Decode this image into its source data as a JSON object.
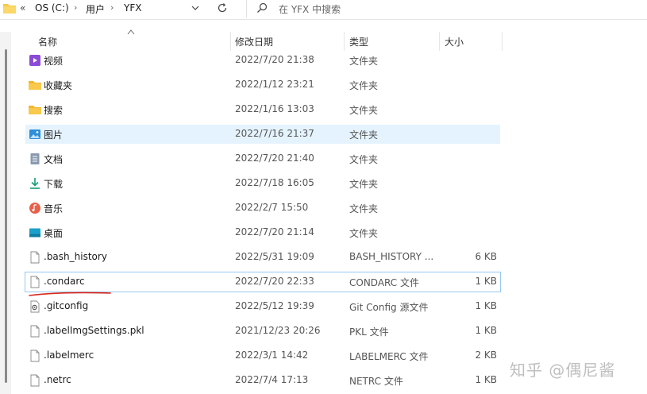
{
  "address_bar": {
    "breadcrumbs": [
      "OS (C:)",
      "用户",
      "YFX"
    ],
    "search_placeholder": "在 YFX 中搜索"
  },
  "columns": {
    "name": "名称",
    "date": "修改日期",
    "type": "类型",
    "size": "大小"
  },
  "rows": [
    {
      "name": "视频",
      "date": "2022/7/20 21:38",
      "type": "文件夹",
      "size": "",
      "icon": "video-folder-icon"
    },
    {
      "name": "收藏夹",
      "date": "2022/1/12 23:21",
      "type": "文件夹",
      "size": "",
      "icon": "folder-icon"
    },
    {
      "name": "搜索",
      "date": "2022/1/16 13:03",
      "type": "文件夹",
      "size": "",
      "icon": "folder-icon"
    },
    {
      "name": "图片",
      "date": "2022/7/16 21:37",
      "type": "文件夹",
      "size": "",
      "icon": "pictures-folder-icon"
    },
    {
      "name": "文档",
      "date": "2022/7/20 21:40",
      "type": "文件夹",
      "size": "",
      "icon": "documents-folder-icon"
    },
    {
      "name": "下载",
      "date": "2022/7/18 16:05",
      "type": "文件夹",
      "size": "",
      "icon": "downloads-folder-icon"
    },
    {
      "name": "音乐",
      "date": "2022/2/7 15:50",
      "type": "文件夹",
      "size": "",
      "icon": "music-folder-icon"
    },
    {
      "name": "桌面",
      "date": "2022/7/20 21:14",
      "type": "文件夹",
      "size": "",
      "icon": "desktop-folder-icon"
    },
    {
      "name": ".bash_history",
      "date": "2022/5/31 19:09",
      "type": "BASH_HISTORY ...",
      "size": "6 KB",
      "icon": "file-icon"
    },
    {
      "name": ".condarc",
      "date": "2022/7/20 22:33",
      "type": "CONDARC 文件",
      "size": "1 KB",
      "icon": "file-icon"
    },
    {
      "name": ".gitconfig",
      "date": "2022/5/12 19:39",
      "type": "Git Config 源文件",
      "size": "1 KB",
      "icon": "gear-file-icon"
    },
    {
      "name": ".labelImgSettings.pkl",
      "date": "2021/12/23 20:26",
      "type": "PKL 文件",
      "size": "1 KB",
      "icon": "file-icon"
    },
    {
      "name": ".labelmerc",
      "date": "2022/3/1 14:42",
      "type": "LABELMERC 文件",
      "size": "2 KB",
      "icon": "file-icon"
    },
    {
      "name": ".netrc",
      "date": "2022/7/4 17:13",
      "type": "NETRC 文件",
      "size": "1 KB",
      "icon": "file-icon"
    }
  ],
  "watermark": "知乎 @偶尼酱",
  "colors": {
    "hover_bg": "#e5f3ff",
    "selected_border": "#99c9ef",
    "folder_yellow": "#f8c94a",
    "annotation_red": "#d9261c"
  }
}
